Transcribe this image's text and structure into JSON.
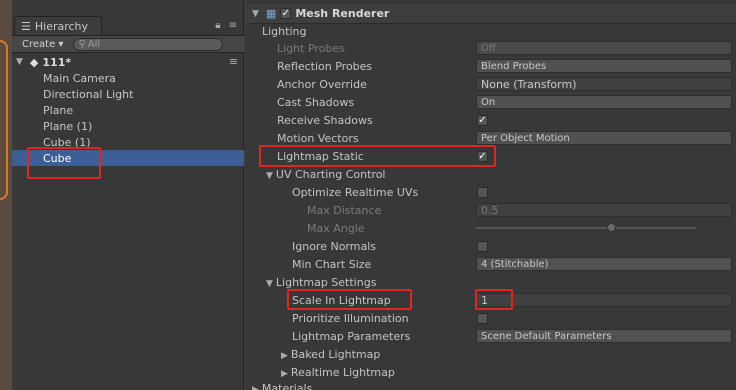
{
  "hierarchy": {
    "tab_label": "Hierarchy",
    "create_label": "Create",
    "search_placeholder": "All",
    "scene_name": "111*",
    "objects": [
      "Main Camera",
      "Directional Light",
      "Plane",
      "Plane (1)",
      "Cube (1)",
      "Cube"
    ],
    "selected": "Cube"
  },
  "inspector": {
    "component_title": "Mesh Renderer",
    "lighting_header": "Lighting",
    "rows": {
      "light_probes": {
        "label": "Light Probes",
        "value": "Off"
      },
      "reflection_probes": {
        "label": "Reflection Probes",
        "value": "Blend Probes"
      },
      "anchor_override": {
        "label": "Anchor Override",
        "value": "None (Transform)"
      },
      "cast_shadows": {
        "label": "Cast Shadows",
        "value": "On"
      },
      "receive_shadows": {
        "label": "Receive Shadows",
        "checked": true
      },
      "motion_vectors": {
        "label": "Motion Vectors",
        "value": "Per Object Motion"
      },
      "lightmap_static": {
        "label": "Lightmap Static",
        "checked": true
      },
      "uv_charting": {
        "label": "UV Charting Control"
      },
      "optimize_uvs": {
        "label": "Optimize Realtime UVs",
        "checked": false
      },
      "max_distance": {
        "label": "Max Distance",
        "value": "0.5"
      },
      "max_angle": {
        "label": "Max Angle"
      },
      "ignore_normals": {
        "label": "Ignore Normals",
        "checked": false
      },
      "min_chart_size": {
        "label": "Min Chart Size",
        "value": "4 (Stitchable)"
      },
      "lightmap_settings": {
        "label": "Lightmap Settings"
      },
      "scale_in_lightmap": {
        "label": "Scale In Lightmap",
        "value": "1"
      },
      "prioritize_illum": {
        "label": "Prioritize Illumination",
        "checked": false
      },
      "lightmap_params": {
        "label": "Lightmap Parameters",
        "value": "Scene Default Parameters"
      },
      "baked_lightmap": {
        "label": "Baked Lightmap"
      },
      "realtime_lightmap": {
        "label": "Realtime Lightmap"
      },
      "materials": {
        "label": "Materials"
      }
    }
  },
  "colors": {
    "highlight": "#e0261e",
    "selection": "#3e5f96"
  }
}
